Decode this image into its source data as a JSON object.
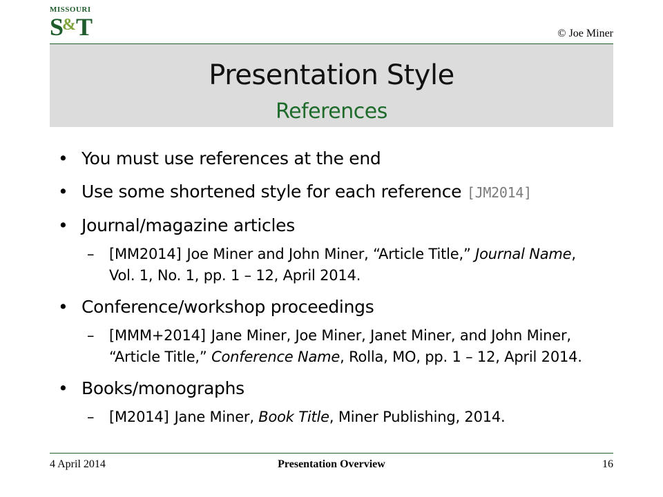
{
  "logo": {
    "top": "MISSOURI",
    "main_left": "S",
    "amp": "&",
    "main_right": "T"
  },
  "copyright": "© Joe Miner",
  "title": "Presentation Style",
  "subtitle": "References",
  "bullets": [
    {
      "text": "You must use references at the end"
    },
    {
      "text": "Use some shortened style for each reference ",
      "ref": "[JM2014]"
    },
    {
      "text": "Journal/magazine articles"
    },
    {
      "text": "Conference/workshop proceedings"
    },
    {
      "text": "Books/monographs"
    }
  ],
  "subs": {
    "journal": {
      "key": "[MM2014]",
      "pre": "Joe Miner and John Miner, “Article Title,” ",
      "italic": "Journal Name",
      "post": ", Vol. 1, No. 1, pp. 1 – 12, April 2014."
    },
    "conference": {
      "key": "[MMM+2014]",
      "pre": "Jane Miner, Joe Miner, Janet Miner, and John Miner, “Article Title,” ",
      "italic": "Conference Name",
      "post": ", Rolla, MO, pp. 1 – 12, April 2014."
    },
    "book": {
      "key": "[M2014]",
      "pre": "Jane Miner, ",
      "italic": "Book Title",
      "post": ", Miner Publishing, 2014."
    }
  },
  "footer": {
    "date": "4 April 2014",
    "center": "Presentation Overview",
    "page": "16"
  }
}
